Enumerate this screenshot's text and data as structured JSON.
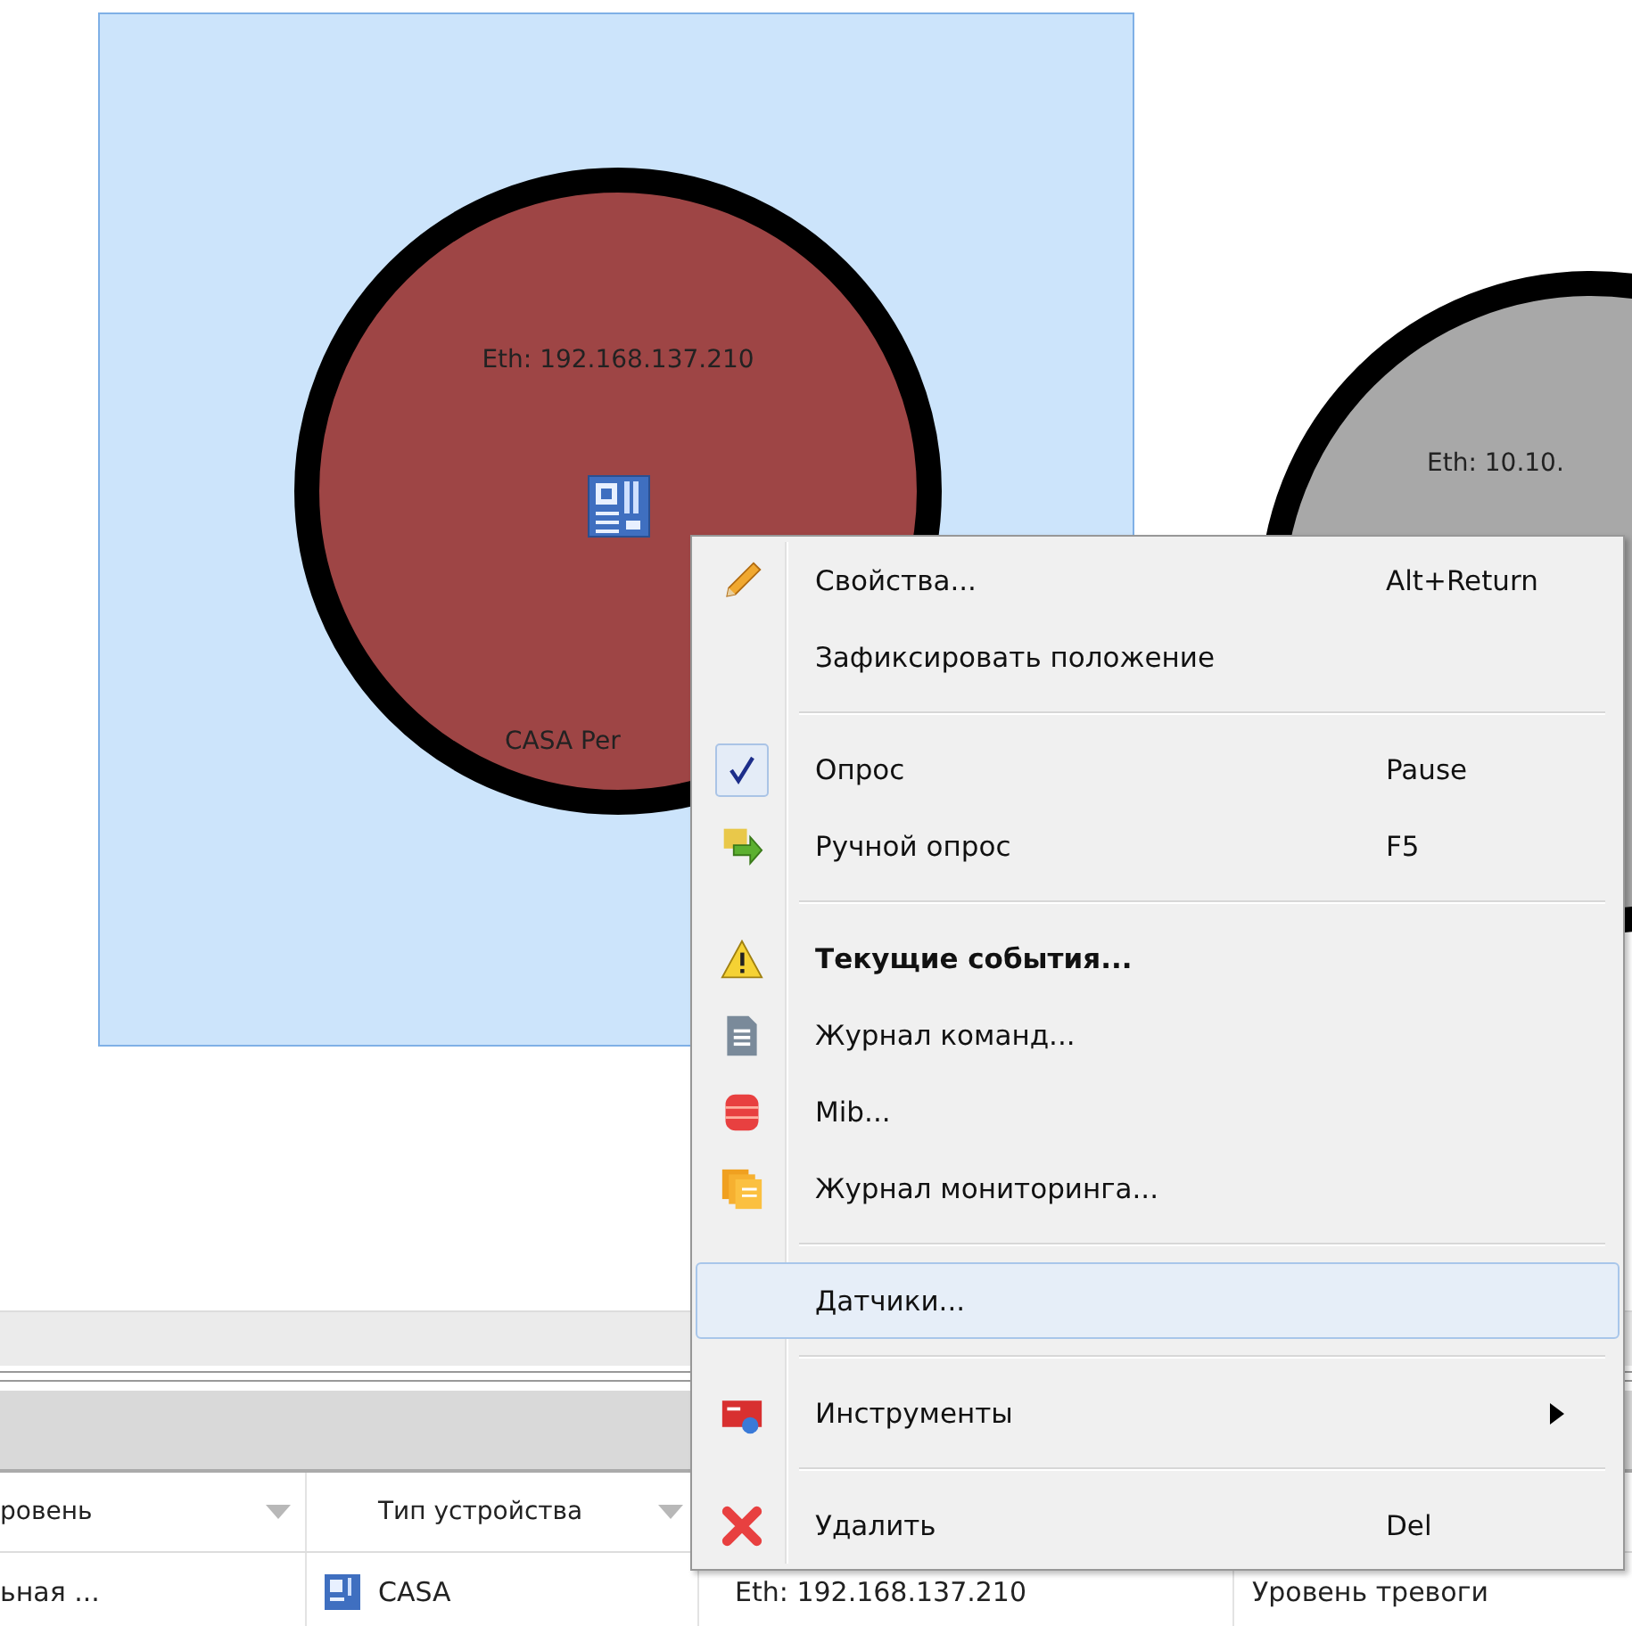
{
  "canvas": {
    "nodes": [
      {
        "address": "Eth: 192.168.137.210",
        "name": "CASA Per",
        "selected": true,
        "color": "#9e4545"
      },
      {
        "address": "Eth: 10.10.",
        "selected": false,
        "color": "#a8a8a8"
      }
    ]
  },
  "context_menu": {
    "items": [
      {
        "kind": "item",
        "label": "Свойства...",
        "shortcut": "Alt+Return",
        "checked": false,
        "selected": false,
        "default": false,
        "submenu": false
      },
      {
        "kind": "item",
        "label": "Зафиксировать положение",
        "checked": false,
        "selected": false,
        "default": false,
        "submenu": false
      },
      {
        "kind": "separator"
      },
      {
        "kind": "item",
        "label": "Опрос",
        "shortcut": "Pause",
        "checked": true,
        "selected": false,
        "default": false,
        "submenu": false
      },
      {
        "kind": "item",
        "label": "Ручной опрос",
        "shortcut": "F5",
        "checked": false,
        "selected": false,
        "default": false,
        "submenu": false
      },
      {
        "kind": "separator"
      },
      {
        "kind": "item",
        "label": "Текущие события...",
        "checked": false,
        "selected": false,
        "default": true,
        "submenu": false
      },
      {
        "kind": "item",
        "label": "Журнал команд...",
        "checked": false,
        "selected": false,
        "default": false,
        "submenu": false
      },
      {
        "kind": "item",
        "label": "Mib...",
        "checked": false,
        "selected": false,
        "default": false,
        "submenu": false
      },
      {
        "kind": "item",
        "label": "Журнал мониторинга...",
        "checked": false,
        "selected": false,
        "default": false,
        "submenu": false
      },
      {
        "kind": "separator"
      },
      {
        "kind": "item",
        "label": "Датчики...",
        "checked": false,
        "selected": true,
        "default": false,
        "submenu": false
      },
      {
        "kind": "separator"
      },
      {
        "kind": "item",
        "label": "Инструменты",
        "checked": false,
        "selected": false,
        "default": false,
        "submenu": true
      },
      {
        "kind": "separator"
      },
      {
        "kind": "item",
        "label": "Удалить",
        "shortcut": "Del",
        "checked": false,
        "selected": false,
        "default": false,
        "submenu": false
      }
    ]
  },
  "table": {
    "columns": [
      "ровень",
      "Тип устройства"
    ],
    "rows": [
      [
        "ьная ...",
        "CASA",
        "Eth: 192.168.137.210",
        "Уровень тревоги"
      ]
    ]
  }
}
